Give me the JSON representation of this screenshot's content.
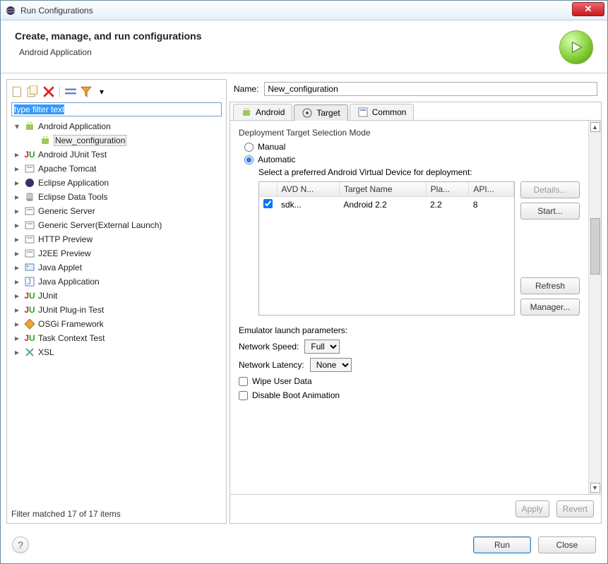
{
  "window": {
    "title": "Run Configurations"
  },
  "header": {
    "title": "Create, manage, and run configurations",
    "subtitle": "Android Application"
  },
  "toolbar": {
    "filter_text": "type filter text"
  },
  "tree": {
    "items": [
      {
        "id": "android-app",
        "label": "Android Application",
        "icon": "android",
        "expand": true
      },
      {
        "id": "new-config",
        "label": "New_configuration",
        "icon": "android",
        "child": true,
        "selected": true
      },
      {
        "id": "junit",
        "label": "Android JUnit Test",
        "icon": "junit"
      },
      {
        "id": "tomcat",
        "label": "Apache Tomcat",
        "icon": "server"
      },
      {
        "id": "eclipse",
        "label": "Eclipse Application",
        "icon": "eclipse"
      },
      {
        "id": "datatools",
        "label": "Eclipse Data Tools",
        "icon": "db"
      },
      {
        "id": "genserver",
        "label": "Generic Server",
        "icon": "server"
      },
      {
        "id": "genserverext",
        "label": "Generic Server(External Launch)",
        "icon": "server"
      },
      {
        "id": "httpprev",
        "label": "HTTP Preview",
        "icon": "server"
      },
      {
        "id": "j2ee",
        "label": "J2EE Preview",
        "icon": "server"
      },
      {
        "id": "applet",
        "label": "Java Applet",
        "icon": "applet"
      },
      {
        "id": "javaapp",
        "label": "Java Application",
        "icon": "java"
      },
      {
        "id": "junit2",
        "label": "JUnit",
        "icon": "junit"
      },
      {
        "id": "junitplugin",
        "label": "JUnit Plug-in Test",
        "icon": "junit"
      },
      {
        "id": "osgi",
        "label": "OSGi Framework",
        "icon": "osgi"
      },
      {
        "id": "taskctx",
        "label": "Task Context Test",
        "icon": "junit"
      },
      {
        "id": "xsl",
        "label": "XSL",
        "icon": "xsl"
      }
    ],
    "status": "Filter matched 17 of 17 items"
  },
  "form": {
    "name_label": "Name:",
    "name_value": "New_configuration",
    "tabs": [
      "Android",
      "Target",
      "Common"
    ],
    "active_tab": 1,
    "target": {
      "group": "Deployment Target Selection Mode",
      "manual": "Manual",
      "automatic": "Automatic",
      "automatic_selected": true,
      "avd_label": "Select a preferred Android Virtual Device for deployment:",
      "columns": [
        "AVD N...",
        "Target Name",
        "Pla...",
        "API..."
      ],
      "rows": [
        {
          "name": "sdk...",
          "target": "Android 2.2",
          "platform": "2.2",
          "api": "8",
          "checked": true
        }
      ],
      "buttons": {
        "details": "Details...",
        "start": "Start...",
        "refresh": "Refresh",
        "manager": "Manager..."
      },
      "emul": {
        "title": "Emulator launch parameters:",
        "speed_label": "Network Speed:",
        "speed": "Full",
        "latency_label": "Network Latency:",
        "latency": "None",
        "wipe": "Wipe User Data",
        "disable_boot": "Disable Boot Animation"
      }
    },
    "apply": "Apply",
    "revert": "Revert"
  },
  "footer": {
    "run": "Run",
    "close": "Close"
  }
}
